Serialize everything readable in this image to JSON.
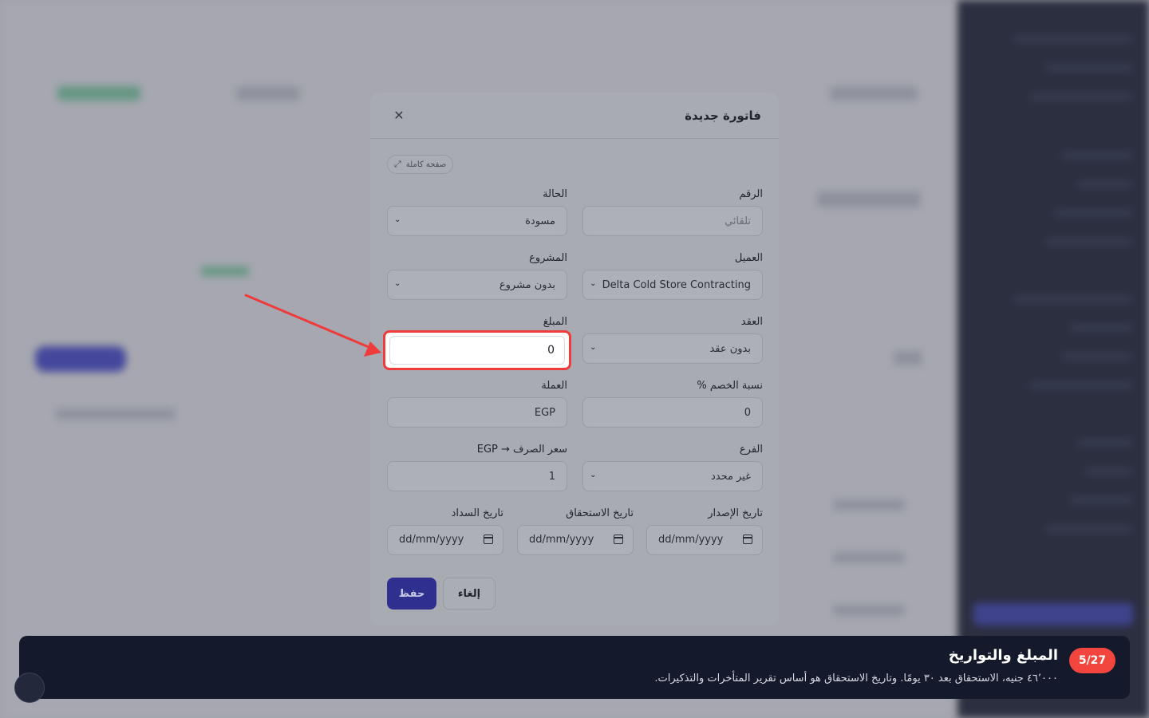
{
  "modal": {
    "title": "فاتورة جديدة",
    "close_icon": "close-icon",
    "fullpage_label": "صفحة كاملة",
    "fullpage_icon": "expand-icon",
    "fields": {
      "number": {
        "label": "الرقم",
        "placeholder": "تلقائي"
      },
      "status": {
        "label": "الحالة",
        "value": "مسودة"
      },
      "client": {
        "label": "العميل",
        "value": "Delta Cold Store Contracting"
      },
      "project": {
        "label": "المشروع",
        "value": "بدون مشروع"
      },
      "contract": {
        "label": "العقد",
        "value": "بدون عقد"
      },
      "amount": {
        "label": "المبلغ",
        "value": "0"
      },
      "discount": {
        "label": "نسبة الخصم %",
        "value": "0"
      },
      "currency": {
        "label": "العملة",
        "value": "EGP"
      },
      "branch": {
        "label": "الفرع",
        "value": "غير محدد"
      },
      "exchange_rate": {
        "label": "سعر الصرف → EGP",
        "value": "1"
      },
      "issue_date": {
        "label": "تاريخ الإصدار",
        "value": "dd/mm/yyyy"
      },
      "due_date": {
        "label": "تاريخ الاستحقاق",
        "value": "dd/mm/yyyy"
      },
      "payment_date": {
        "label": "تاريخ السداد",
        "value": "dd/mm/yyyy"
      }
    },
    "buttons": {
      "save": "حفظ",
      "cancel": "إلغاء"
    }
  },
  "tour": {
    "step": "5/27",
    "title": "المبلغ والتواريخ",
    "text": "٤٦٬٠٠٠ جنيه، الاستحقاق بعد ٣٠ يومًا. وتاريخ الاستحقاق هو أساس تقرير المتأخرات والتذكيرات."
  },
  "colors": {
    "accent": "#2e2f8f",
    "highlight": "#ef3b3b",
    "tour_bg": "#141a2c",
    "badge": "#f2453d"
  }
}
